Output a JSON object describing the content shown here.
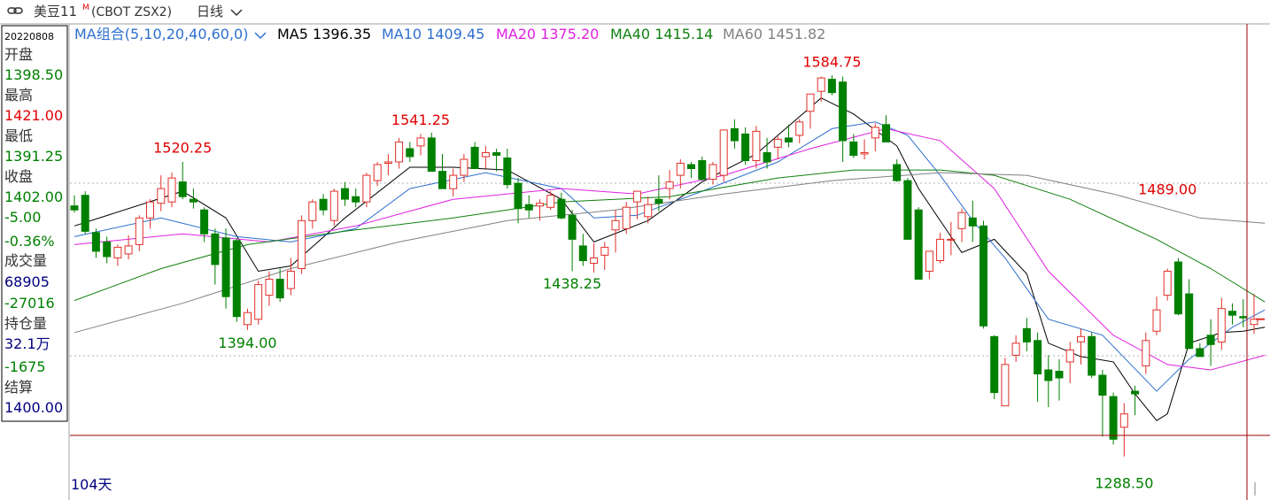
{
  "header": {
    "symbol_name": "美豆11",
    "symbol_sup": "M",
    "symbol_code": "(CBOT ZSX2)",
    "period": "日线"
  },
  "ma_legend": {
    "group_label": "MA组合(5,10,20,40,60,0)",
    "items": [
      {
        "label": "MA5 1396.35",
        "color": "#000000"
      },
      {
        "label": "MA10 1409.45",
        "color": "#2e6fcf"
      },
      {
        "label": "MA20 1375.20",
        "color": "#e020e0"
      },
      {
        "label": "MA40 1415.14",
        "color": "#108010"
      },
      {
        "label": "MA60 1451.82",
        "color": "#808080"
      }
    ]
  },
  "info_panel": {
    "date": "20220808",
    "open_label": "开盘",
    "open": "1398.50",
    "high_label": "最高",
    "high": "1421.00",
    "low_label": "最低",
    "low": "1391.25",
    "close_label": "收盘",
    "close": "1402.00",
    "change": "-5.00",
    "change_pct": "-0.36%",
    "volume_label": "成交量",
    "volume": "68905",
    "volume_change": "-27016",
    "oi_label": "持仓量",
    "oi": "32.1万",
    "oi_change": "-1675",
    "settle_label": "结算",
    "settle": "1400.00"
  },
  "footer": {
    "days": "104天"
  },
  "colors": {
    "up": "#e0302a",
    "down": "#008000",
    "crosshair": "#a00000",
    "peak_label": "#e00000",
    "trough_label": "#008000"
  },
  "chart_data": {
    "type": "candlestick",
    "ylim": [
      1275,
      1605
    ],
    "candles": [
      [
        1487,
        1495,
        1482,
        1484
      ],
      [
        1495,
        1498,
        1466,
        1468
      ],
      [
        1467,
        1470,
        1448,
        1453
      ],
      [
        1460,
        1464,
        1444,
        1449
      ],
      [
        1448,
        1458,
        1442,
        1456
      ],
      [
        1451,
        1465,
        1447,
        1457
      ],
      [
        1458,
        1480,
        1453,
        1478
      ],
      [
        1478,
        1492,
        1470,
        1490
      ],
      [
        1489,
        1510,
        1483,
        1500
      ],
      [
        1490,
        1512,
        1486,
        1508
      ],
      [
        1505,
        1520,
        1492,
        1494
      ],
      [
        1492,
        1500,
        1485,
        1490
      ],
      [
        1484,
        1486,
        1460,
        1466
      ],
      [
        1466,
        1470,
        1428,
        1443
      ],
      [
        1463,
        1470,
        1410,
        1419
      ],
      [
        1461,
        1463,
        1400,
        1404
      ],
      [
        1398,
        1410,
        1394,
        1407
      ],
      [
        1402,
        1431,
        1398,
        1428
      ],
      [
        1420,
        1438,
        1412,
        1432
      ],
      [
        1432,
        1440,
        1415,
        1418
      ],
      [
        1425,
        1448,
        1420,
        1438
      ],
      [
        1440,
        1480,
        1436,
        1476
      ],
      [
        1476,
        1492,
        1470,
        1490
      ],
      [
        1492,
        1496,
        1480,
        1484
      ],
      [
        1476,
        1500,
        1472,
        1498
      ],
      [
        1500,
        1505,
        1487,
        1492
      ],
      [
        1494,
        1500,
        1486,
        1490
      ],
      [
        1490,
        1512,
        1486,
        1510
      ],
      [
        1506,
        1520,
        1502,
        1518
      ],
      [
        1519,
        1526,
        1510,
        1520
      ],
      [
        1520,
        1538,
        1515,
        1535
      ],
      [
        1530,
        1535,
        1520,
        1524
      ],
      [
        1532,
        1541,
        1525,
        1538
      ],
      [
        1538,
        1542,
        1520,
        1513
      ],
      [
        1513,
        1526,
        1502,
        1500
      ],
      [
        1500,
        1515,
        1494,
        1510
      ],
      [
        1510,
        1526,
        1505,
        1522
      ],
      [
        1531,
        1535,
        1519,
        1515
      ],
      [
        1524,
        1532,
        1515,
        1527
      ],
      [
        1527,
        1530,
        1513,
        1525
      ],
      [
        1523,
        1530,
        1500,
        1503
      ],
      [
        1504,
        1508,
        1474,
        1485
      ],
      [
        1488,
        1495,
        1478,
        1484
      ],
      [
        1487,
        1492,
        1476,
        1489
      ],
      [
        1486,
        1498,
        1484,
        1495
      ],
      [
        1492,
        1497,
        1477,
        1478
      ],
      [
        1480,
        1484,
        1438,
        1462
      ],
      [
        1457,
        1466,
        1442,
        1446
      ],
      [
        1444,
        1459,
        1437,
        1448
      ],
      [
        1450,
        1460,
        1439,
        1456
      ],
      [
        1469,
        1484,
        1452,
        1476
      ],
      [
        1470,
        1490,
        1466,
        1486
      ],
      [
        1490,
        1496,
        1477,
        1498
      ],
      [
        1479,
        1494,
        1474,
        1488
      ],
      [
        1492,
        1510,
        1483,
        1489
      ],
      [
        1500,
        1514,
        1492,
        1505
      ],
      [
        1510,
        1522,
        1500,
        1519
      ],
      [
        1518,
        1520,
        1508,
        1515
      ],
      [
        1521,
        1524,
        1506,
        1507
      ],
      [
        1507,
        1520,
        1503,
        1518
      ],
      [
        1510,
        1530,
        1505,
        1544
      ],
      [
        1545,
        1552,
        1530,
        1536
      ],
      [
        1541,
        1546,
        1518,
        1521
      ],
      [
        1521,
        1547,
        1515,
        1543
      ],
      [
        1527,
        1538,
        1515,
        1520
      ],
      [
        1531,
        1539,
        1522,
        1537
      ],
      [
        1538,
        1548,
        1531,
        1535
      ],
      [
        1540,
        1552,
        1534,
        1550
      ],
      [
        1558,
        1570,
        1545,
        1571
      ],
      [
        1573,
        1584,
        1565,
        1583
      ],
      [
        1582,
        1585,
        1570,
        1572
      ],
      [
        1580,
        1584,
        1520,
        1536
      ],
      [
        1535,
        1541,
        1523,
        1525
      ],
      [
        1526,
        1537,
        1522,
        1527
      ],
      [
        1538,
        1549,
        1528,
        1546
      ],
      [
        1548,
        1555,
        1535,
        1535
      ],
      [
        1518,
        1522,
        1505,
        1506
      ],
      [
        1506,
        1508,
        1462,
        1462
      ],
      [
        1484,
        1486,
        1432,
        1432
      ],
      [
        1438,
        1453,
        1432,
        1453
      ],
      [
        1446,
        1467,
        1444,
        1462
      ],
      [
        1462,
        1475,
        1450,
        1462
      ],
      [
        1470,
        1485,
        1460,
        1482
      ],
      [
        1478,
        1491,
        1460,
        1472
      ],
      [
        1472,
        1476,
        1395,
        1397
      ],
      [
        1389,
        1390,
        1342,
        1347
      ],
      [
        1337,
        1373,
        1341,
        1368
      ],
      [
        1375,
        1390,
        1370,
        1384
      ],
      [
        1395,
        1403,
        1378,
        1385
      ],
      [
        1386,
        1392,
        1340,
        1361
      ],
      [
        1364,
        1375,
        1336,
        1356
      ],
      [
        1363,
        1372,
        1341,
        1358
      ],
      [
        1370,
        1385,
        1354,
        1379
      ],
      [
        1385,
        1395,
        1368,
        1389
      ],
      [
        1389,
        1392,
        1358,
        1360
      ],
      [
        1360,
        1364,
        1314,
        1345
      ],
      [
        1344,
        1347,
        1308,
        1312
      ],
      [
        1321,
        1339,
        1299,
        1331
      ],
      [
        1348,
        1352,
        1330,
        1346
      ],
      [
        1367,
        1392,
        1361,
        1386
      ],
      [
        1393,
        1419,
        1390,
        1409
      ],
      [
        1420,
        1440,
        1416,
        1438
      ],
      [
        1445,
        1448,
        1405,
        1406
      ],
      [
        1421,
        1432,
        1386,
        1380
      ],
      [
        1380,
        1384,
        1395,
        1374
      ],
      [
        1390,
        1402,
        1367,
        1383
      ],
      [
        1385,
        1418,
        1379,
        1410
      ],
      [
        1408,
        1414,
        1398,
        1405
      ],
      [
        1404,
        1417,
        1396,
        1403
      ],
      [
        1398,
        1421,
        1391,
        1402
      ]
    ],
    "ma": {
      "MA5": [
        [
          0,
          1472
        ],
        [
          10,
          1498
        ],
        [
          14,
          1478
        ],
        [
          17,
          1438
        ],
        [
          20,
          1442
        ],
        [
          25,
          1478
        ],
        [
          31,
          1516
        ],
        [
          35,
          1516
        ],
        [
          40,
          1514
        ],
        [
          45,
          1492
        ],
        [
          48,
          1460
        ],
        [
          53,
          1476
        ],
        [
          58,
          1505
        ],
        [
          63,
          1526
        ],
        [
          69,
          1568
        ],
        [
          72,
          1556
        ],
        [
          76,
          1532
        ],
        [
          78,
          1500
        ],
        [
          82,
          1452
        ],
        [
          85,
          1462
        ],
        [
          88,
          1436
        ],
        [
          90,
          1384
        ],
        [
          93,
          1374
        ],
        [
          96,
          1370
        ],
        [
          98,
          1346
        ],
        [
          100,
          1326
        ],
        [
          101,
          1331
        ],
        [
          103,
          1384
        ],
        [
          106,
          1392
        ],
        [
          108,
          1393
        ],
        [
          110,
          1396
        ]
      ],
      "MA10": [
        [
          0,
          1464
        ],
        [
          8,
          1478
        ],
        [
          15,
          1464
        ],
        [
          20,
          1460
        ],
        [
          26,
          1470
        ],
        [
          31,
          1500
        ],
        [
          38,
          1512
        ],
        [
          45,
          1500
        ],
        [
          48,
          1478
        ],
        [
          52,
          1480
        ],
        [
          58,
          1498
        ],
        [
          65,
          1520
        ],
        [
          70,
          1545
        ],
        [
          74,
          1550
        ],
        [
          77,
          1540
        ],
        [
          80,
          1510
        ],
        [
          83,
          1476
        ],
        [
          86,
          1448
        ],
        [
          90,
          1402
        ],
        [
          95,
          1390
        ],
        [
          100,
          1348
        ],
        [
          103,
          1372
        ],
        [
          107,
          1396
        ],
        [
          110,
          1409
        ]
      ],
      "MA20": [
        [
          0,
          1458
        ],
        [
          10,
          1466
        ],
        [
          18,
          1460
        ],
        [
          26,
          1472
        ],
        [
          35,
          1492
        ],
        [
          45,
          1500
        ],
        [
          52,
          1496
        ],
        [
          60,
          1510
        ],
        [
          68,
          1530
        ],
        [
          75,
          1545
        ],
        [
          80,
          1536
        ],
        [
          85,
          1500
        ],
        [
          90,
          1438
        ],
        [
          96,
          1390
        ],
        [
          101,
          1368
        ],
        [
          105,
          1364
        ],
        [
          110,
          1375
        ]
      ],
      "MA40": [
        [
          0,
          1416
        ],
        [
          8,
          1440
        ],
        [
          16,
          1458
        ],
        [
          25,
          1468
        ],
        [
          35,
          1478
        ],
        [
          45,
          1490
        ],
        [
          55,
          1494
        ],
        [
          65,
          1508
        ],
        [
          72,
          1514
        ],
        [
          80,
          1514
        ],
        [
          85,
          1510
        ],
        [
          92,
          1492
        ],
        [
          100,
          1462
        ],
        [
          105,
          1440
        ],
        [
          110,
          1415
        ]
      ],
      "MA60": [
        [
          0,
          1392
        ],
        [
          10,
          1414
        ],
        [
          20,
          1440
        ],
        [
          30,
          1460
        ],
        [
          40,
          1476
        ],
        [
          50,
          1484
        ],
        [
          60,
          1496
        ],
        [
          70,
          1506
        ],
        [
          80,
          1512
        ],
        [
          88,
          1510
        ],
        [
          96,
          1496
        ],
        [
          104,
          1478
        ],
        [
          110,
          1474
        ]
      ]
    },
    "annotations": [
      {
        "label": "1520.25",
        "index": 10,
        "value": 1520.25,
        "kind": "peak"
      },
      {
        "label": "1394.00",
        "index": 16,
        "value": 1394.0,
        "kind": "trough"
      },
      {
        "label": "1541.25",
        "index": 32,
        "value": 1541.25,
        "kind": "peak"
      },
      {
        "label": "1438.25",
        "index": 46,
        "value": 1438.25,
        "kind": "trough"
      },
      {
        "label": "1584.75",
        "index": 70,
        "value": 1584.75,
        "kind": "peak"
      },
      {
        "label": "1489.00",
        "index": 101,
        "value": 1489.0,
        "kind": "peak"
      },
      {
        "label": "1288.50",
        "index": 97,
        "value": 1288.5,
        "kind": "trough"
      }
    ]
  }
}
